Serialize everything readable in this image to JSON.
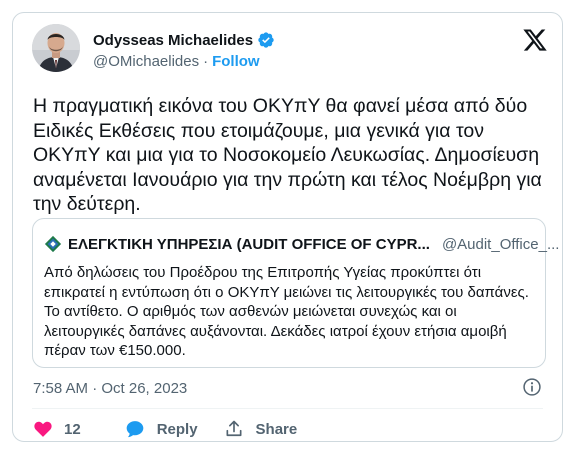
{
  "author": {
    "name": "Odysseas Michaelides",
    "handle": "@OMichaelides",
    "separator": "·",
    "follow_label": "Follow",
    "verified_color": "#1d9bf0"
  },
  "tweet": {
    "text": "Η πραγματική εικόνα του ΟΚΥπΥ θα φανεί μέσα από δύο Ειδικές Εκθέσεις που ετοιμάζουμε, μια γενικά για τον ΟΚΥπΥ και μια για το Νοσοκομείο Λευκωσίας. Δημοσίευση αναμένεται Ιανουάριο για την πρώτη και τέλος Νοέμβρη για την δεύτερη.",
    "timestamp": "7:58 AM · Oct 26, 2023"
  },
  "quoted_tweet": {
    "name": "ΕΛΕΓΚΤΙΚΗ ΥΠΗΡΕΣΙΑ (AUDIT OFFICE OF CYPR...",
    "handle": "@Audit_Office_...",
    "text": "Από δηλώσεις του Προέδρου της Επιτροπής Υγείας προκύπτει ότι επικρατεί η εντύπωση ότι ο ΟΚΥπΥ μειώνει τις λειτουργικές του δαπάνες. Το αντίθετο. Ο αριθμός των ασθενών μειώνεται συνεχώς και οι λειτουργικές δαπάνες αυξάνονται. Δεκάδες ιατροί έχουν ετήσια αμοιβή πέραν των €150.000."
  },
  "actions": {
    "like_count": "12",
    "reply_label": "Reply",
    "share_label": "Share"
  },
  "colors": {
    "accent": "#1d9bf0",
    "like": "#f91880",
    "secondary_text": "#536471",
    "border": "#cfd9de"
  },
  "icons": [
    "x-logo-icon",
    "verified-badge-icon",
    "heart-icon",
    "reply-bubble-icon",
    "share-icon",
    "info-icon",
    "audit-office-logo-icon"
  ]
}
